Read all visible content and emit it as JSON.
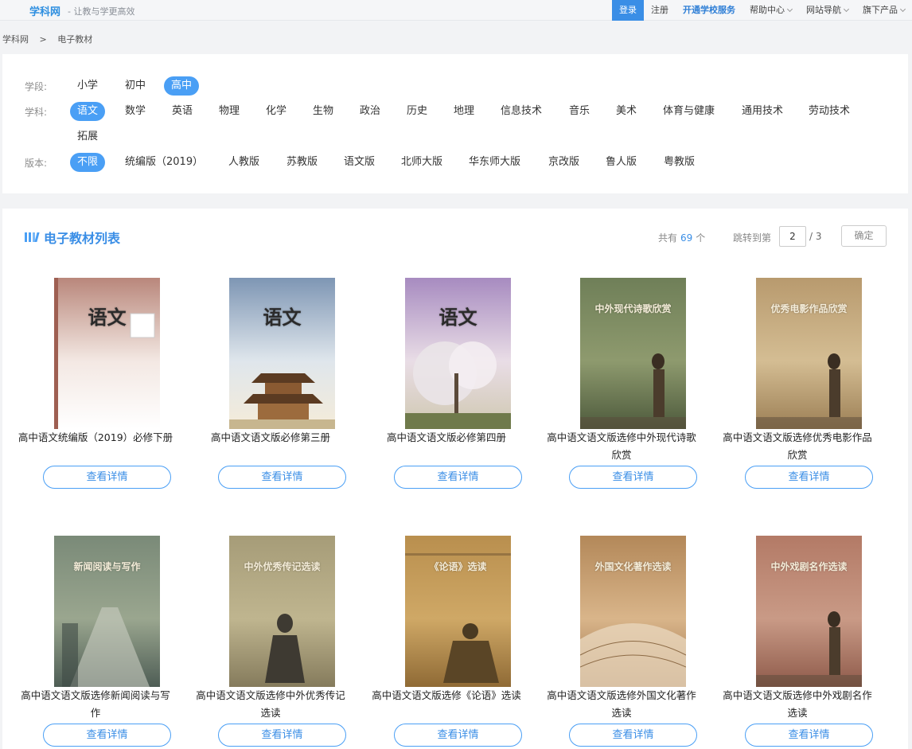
{
  "header": {
    "brand": "学科网",
    "slogan": "- 让教与学更高效",
    "links": [
      {
        "label": "登录",
        "caret": false
      },
      {
        "label": "注册",
        "caret": false
      },
      {
        "label": "开通学校服务",
        "caret": false
      },
      {
        "label": "帮助中心",
        "caret": true
      },
      {
        "label": "网站导航",
        "caret": true
      },
      {
        "label": "旗下产品",
        "caret": true
      }
    ]
  },
  "breadcrumb": [
    "学科网",
    ">",
    "电子教材"
  ],
  "filters": {
    "stage": {
      "label": "学段:",
      "options": [
        "小学",
        "初中",
        "高中"
      ],
      "selected": "高中"
    },
    "subject": {
      "label": "学科:",
      "options": [
        "语文",
        "数学",
        "英语",
        "物理",
        "化学",
        "生物",
        "政治",
        "历史",
        "地理",
        "信息技术",
        "音乐",
        "美术",
        "体育与健康",
        "通用技术",
        "劳动技术",
        "拓展"
      ],
      "selected": "语文"
    },
    "edition": {
      "label": "版本:",
      "options": [
        "不限",
        "统编版（2019）",
        "人教版",
        "苏教版",
        "语文版",
        "北师大版",
        "华东师大版",
        "京改版",
        "鲁人版",
        "粤教版"
      ],
      "selected": "不限"
    }
  },
  "list": {
    "title": "电子教材列表",
    "total_prefix": "共有",
    "total": "69",
    "total_suffix": "个",
    "jump_label": "跳转到第",
    "page_value": "2",
    "page_total": "/ 3",
    "confirm": "确定",
    "detail_label": "查看详情",
    "books": [
      {
        "title": "高中语文统编版（2019）必修下册",
        "cover_text": "语文"
      },
      {
        "title": "高中语文语文版必修第三册",
        "cover_text": "语文"
      },
      {
        "title": "高中语文语文版必修第四册",
        "cover_text": "语文"
      },
      {
        "title": "高中语文语文版选修中外现代诗歌欣赏",
        "cover_text": "中外现代诗歌欣赏"
      },
      {
        "title": "高中语文语文版选修优秀电影作品欣赏",
        "cover_text": "优秀电影作品欣赏"
      },
      {
        "title": "高中语文语文版选修新闻阅读与写作",
        "cover_text": "新闻阅读与写作"
      },
      {
        "title": "高中语文语文版选修中外优秀传记选读",
        "cover_text": "中外优秀传记选读"
      },
      {
        "title": "高中语文语文版选修《论语》选读",
        "cover_text": "《论语》选读"
      },
      {
        "title": "高中语文语文版选修外国文化著作选读",
        "cover_text": "外国文化著作选读"
      },
      {
        "title": "高中语文语文版选修中外戏剧名作选读",
        "cover_text": "中外戏剧名作选读"
      }
    ]
  },
  "colors": {
    "accent": "#3a8ee6",
    "chip_active": "#4a9ff5"
  }
}
